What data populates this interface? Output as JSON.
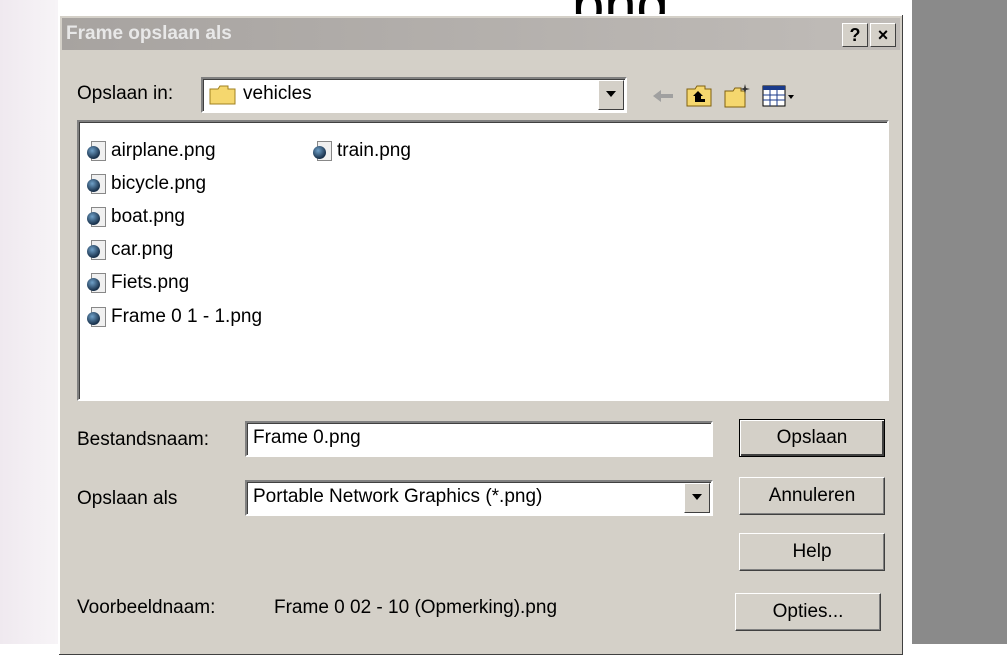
{
  "background": {
    "top_text": "png"
  },
  "dialog": {
    "title": "Frame opslaan als",
    "help_button": "?",
    "close_button": "×"
  },
  "save_in": {
    "label": "Opslaan in:",
    "folder": "vehicles"
  },
  "toolbar": {
    "icons": [
      "back-arrow-icon",
      "up-folder-icon",
      "new-folder-icon",
      "view-menu-icon"
    ]
  },
  "files": [
    {
      "name": "airplane.png"
    },
    {
      "name": "bicycle.png"
    },
    {
      "name": "boat.png"
    },
    {
      "name": "car.png"
    },
    {
      "name": "Fiets.png"
    },
    {
      "name": "Frame 0 1 - 1.png"
    },
    {
      "name": "train.png"
    }
  ],
  "filename": {
    "label": "Bestandsnaam:",
    "value": "Frame 0.png"
  },
  "filetype": {
    "label": "Opslaan als",
    "value": "Portable Network Graphics (*.png)"
  },
  "buttons": {
    "save": "Opslaan",
    "cancel": "Annuleren",
    "help": "Help",
    "options": "Opties..."
  },
  "preview": {
    "label": "Voorbeeldnaam:",
    "value": "Frame 0 02 - 10 (Opmerking).png"
  },
  "colors": {
    "dialog_bg": "#d4d0c8",
    "titlebar": "#a7a3a0"
  }
}
